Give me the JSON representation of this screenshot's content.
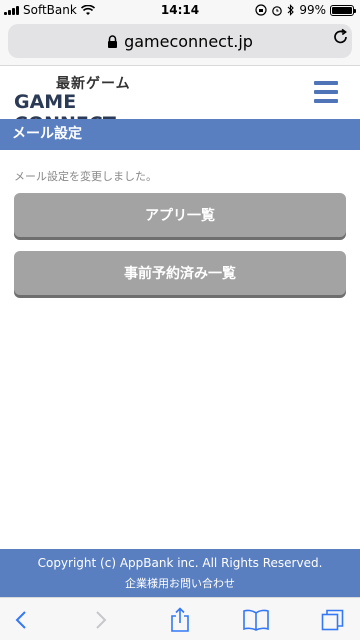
{
  "status": {
    "carrier": "SoftBank",
    "time": "14:14",
    "battery": "99%",
    "battery_level": 0.99
  },
  "browser": {
    "url": "gameconnect.jp"
  },
  "site": {
    "logo_top": "最新ゲーム",
    "logo_main": "GAME CONNECT"
  },
  "page": {
    "title": "メール設定",
    "message": "メール設定を変更しました。",
    "buttons": [
      "アプリ一覧",
      "事前予約済み一覧"
    ]
  },
  "footer": {
    "copyright": "Copyright (c) AppBank inc. All Rights Reserved.",
    "contact": "企業様用お問い合わせ"
  },
  "colors": {
    "accent": "#5a7fc0",
    "menu": "#4f74b8",
    "button": "#a3a3a3",
    "ios_blue": "#3478f6"
  }
}
